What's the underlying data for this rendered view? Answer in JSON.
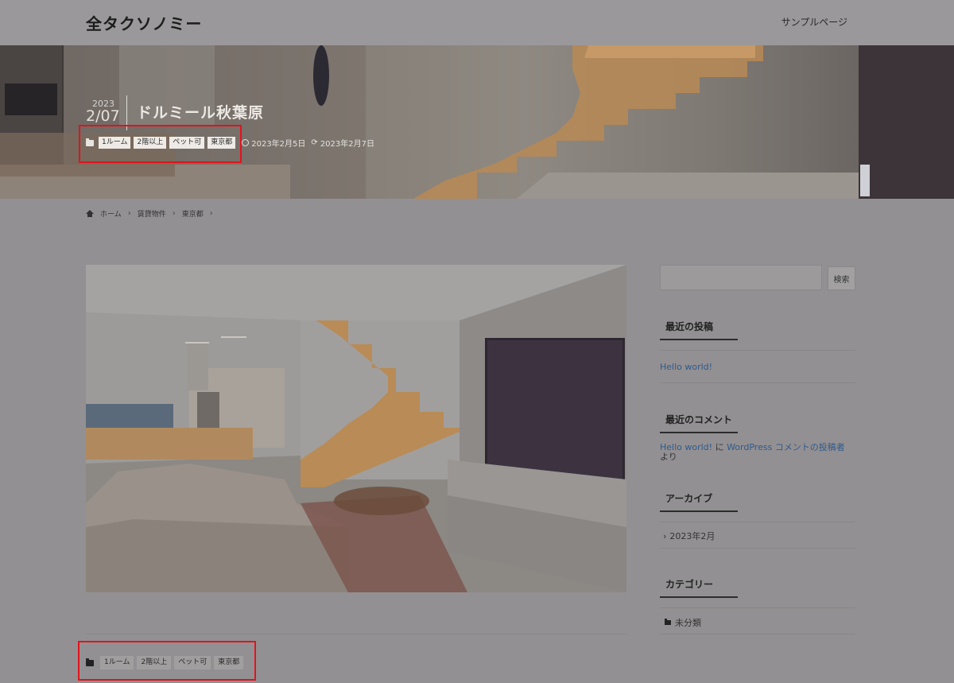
{
  "header": {
    "site_title": "全タクソノミー",
    "nav_sample": "サンプルページ"
  },
  "hero": {
    "year": "2023",
    "day": "2/07",
    "title": "ドルミール秋葉原",
    "tags": [
      "1ルーム",
      "2階以上",
      "ペット可",
      "東京都"
    ],
    "published": "2023年2月5日",
    "updated": "2023年2月7日"
  },
  "breadcrumb": {
    "home": "ホーム",
    "items": [
      "賃貸物件",
      "東京都"
    ]
  },
  "post": {
    "tags": [
      "1ルーム",
      "2階以上",
      "ペット可",
      "東京都"
    ]
  },
  "sidebar": {
    "search_placeholder": "",
    "search_button": "検索",
    "recent_posts_title": "最近の投稿",
    "recent_posts": [
      "Hello world!"
    ],
    "recent_comments_title": "最近のコメント",
    "comment_post": "Hello world!",
    "comment_on": "に",
    "comment_author": "WordPress コメントの投稿者",
    "comment_by": "より",
    "archive_title": "アーカイブ",
    "archives": [
      "2023年2月"
    ],
    "category_title": "カテゴリー",
    "categories": [
      "未分類"
    ]
  },
  "colors": {
    "highlight_box": "#e2131c",
    "link": "#2e5a8a"
  }
}
